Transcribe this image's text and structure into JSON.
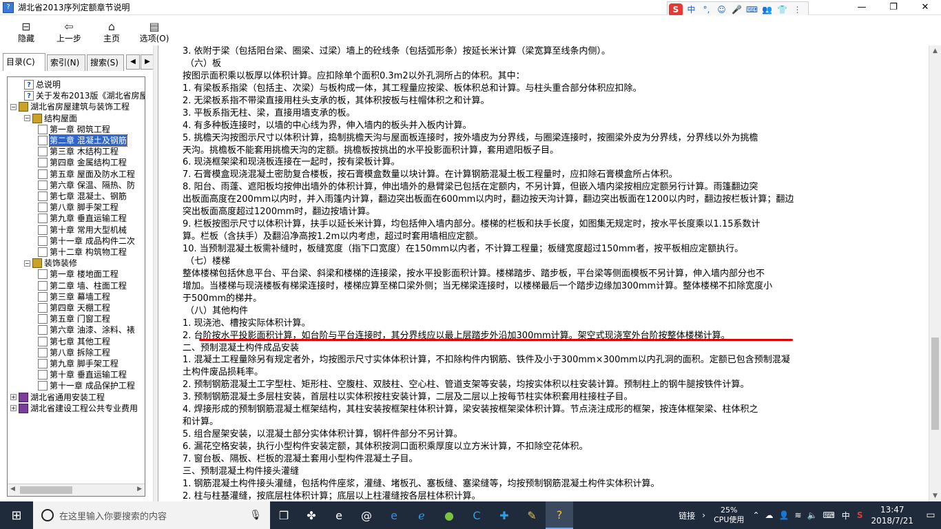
{
  "window": {
    "title": "湖北省2013序列定额章节说明",
    "app_icon": "help-file-icon",
    "minimize": "—",
    "maximize": "❐",
    "close": "✕"
  },
  "ime": {
    "logo": "S",
    "mode": "中",
    "items": [
      "°,",
      "☺",
      "🎤",
      "⌨",
      "👥",
      "👕",
      "⋮"
    ]
  },
  "toolbar": [
    {
      "label": "隐藏",
      "icon": "hide-icon",
      "glyph": "⊟"
    },
    {
      "label": "上一步",
      "icon": "back-icon",
      "glyph": "⇦"
    },
    {
      "label": "主页",
      "icon": "home-icon",
      "glyph": "⌂"
    },
    {
      "label": "选项(O)",
      "icon": "options-icon",
      "glyph": "▤"
    }
  ],
  "tabs": [
    "目录(C)",
    "索引(N)",
    "搜索(S)"
  ],
  "tree": [
    {
      "level": 1,
      "expander": "",
      "icon": "help-page-icon",
      "label": "总说明"
    },
    {
      "level": 1,
      "expander": "",
      "icon": "help-page-icon",
      "label": "关于发布2013版《湖北省房屋"
    },
    {
      "level": 0,
      "expander": "−",
      "icon": "open-book-icon",
      "label": "湖北省房屋建筑与装饰工程"
    },
    {
      "level": 1,
      "expander": "−",
      "icon": "open-book-icon",
      "label": "结构屋面"
    },
    {
      "level": 2,
      "expander": "",
      "icon": "page-icon",
      "label": "第一章 砌筑工程"
    },
    {
      "level": 2,
      "expander": "",
      "icon": "page-icon",
      "label": "第二章 混凝土及钢筋",
      "selected": true
    },
    {
      "level": 2,
      "expander": "",
      "icon": "page-icon",
      "label": "第三章 木结构工程"
    },
    {
      "level": 2,
      "expander": "",
      "icon": "page-icon",
      "label": "第四章 金属结构工程"
    },
    {
      "level": 2,
      "expander": "",
      "icon": "page-icon",
      "label": "第五章 屋面及防水工程"
    },
    {
      "level": 2,
      "expander": "",
      "icon": "page-icon",
      "label": "第六章 保温、隔热、防"
    },
    {
      "level": 2,
      "expander": "",
      "icon": "page-icon",
      "label": "第七章 混凝土、钢筋"
    },
    {
      "level": 2,
      "expander": "",
      "icon": "page-icon",
      "label": "第八章 脚手架工程"
    },
    {
      "level": 2,
      "expander": "",
      "icon": "page-icon",
      "label": "第九章 垂直运输工程"
    },
    {
      "level": 2,
      "expander": "",
      "icon": "page-icon",
      "label": "第十章 常用大型机械"
    },
    {
      "level": 2,
      "expander": "",
      "icon": "page-icon",
      "label": "第十一章 成品构件二次"
    },
    {
      "level": 2,
      "expander": "",
      "icon": "page-icon",
      "label": "第十二章 构筑物工程"
    },
    {
      "level": 1,
      "expander": "−",
      "icon": "open-book-icon",
      "label": "装饰装修"
    },
    {
      "level": 2,
      "expander": "",
      "icon": "page-icon",
      "label": "第一章 楼地面工程"
    },
    {
      "level": 2,
      "expander": "",
      "icon": "page-icon",
      "label": "第二章 墙、柱面工程"
    },
    {
      "level": 2,
      "expander": "",
      "icon": "page-icon",
      "label": "第三章 幕墙工程"
    },
    {
      "level": 2,
      "expander": "",
      "icon": "page-icon",
      "label": "第四章 天棚工程"
    },
    {
      "level": 2,
      "expander": "",
      "icon": "page-icon",
      "label": "第五章 门窗工程"
    },
    {
      "level": 2,
      "expander": "",
      "icon": "page-icon",
      "label": "第六章 油漆、涂料、裱"
    },
    {
      "level": 2,
      "expander": "",
      "icon": "page-icon",
      "label": "第七章 其他工程"
    },
    {
      "level": 2,
      "expander": "",
      "icon": "page-icon",
      "label": "第八章 拆除工程"
    },
    {
      "level": 2,
      "expander": "",
      "icon": "page-icon",
      "label": "第九章 脚手架工程"
    },
    {
      "level": 2,
      "expander": "",
      "icon": "page-icon",
      "label": "第十章 垂直运输工程"
    },
    {
      "level": 2,
      "expander": "",
      "icon": "page-icon",
      "label": "第十一章 成品保护工程"
    },
    {
      "level": 0,
      "expander": "+",
      "icon": "closed-book-icon",
      "label": "湖北省通用安装工程"
    },
    {
      "level": 0,
      "expander": "+",
      "icon": "closed-book-icon",
      "label": "湖北省建设工程公共专业费用"
    }
  ],
  "content": [
    {
      "text": "3. 依附于梁（包括阳台梁、圈梁、过梁）墙上的砼线条（包括弧形条）按延长米计算（梁宽算至线条内侧）。"
    },
    {
      "text": "（六）板",
      "sub": true
    },
    {
      "text": "按图示面积乘以板厚以体积计算。应扣除单个面积0.3m2以外孔洞所占的体积。其中："
    },
    {
      "text": "1. 有梁板系指梁（包括主、次梁）与板构成一体，其工程量应按梁、板体积总和计算。与柱头重合部分体积应扣除。"
    },
    {
      "text": "2. 无梁板系指不带梁直接用柱头支承的板，其体积按板与柱帽体积之和计算。"
    },
    {
      "text": "3. 平板系指无柱、梁，直接用墙支承的板。"
    },
    {
      "text": "4. 有多种板连接时，以墙的中心线为界，伸入墙内的板头并入板内计算。"
    },
    {
      "text": "5. 挑檐天沟按图示尺寸以体积计算，捣制挑檐天沟与屋面板连接时，按外墙皮为分界线，与圈梁连接时，按圈梁外皮为分界线，分界线以外为挑檐"
    },
    {
      "text": "天沟。挑檐板不能套用挑檐天沟的定额。挑檐板按挑出的水平投影面积计算，套用遮阳板子目。"
    },
    {
      "text": "6. 现浇框架梁和现浇板连接在一起时，按有梁板计算。"
    },
    {
      "text": "7. 石膏模盒现浇混凝土密肋复合楼板，按石膏模盒数量以块计算。在计算钢筋混凝土板工程量时，应扣除石膏模盒所占体积。"
    },
    {
      "text": "8. 阳台、雨蓬、遮阳板均按伸出墙外的体积计算，伸出墙外的悬臂梁已包括在定额内，不另计算，但嵌入墙内梁按相应定额另行计算。雨篷翻边突"
    },
    {
      "text": "出板面高度在200mm以内时，并入雨篷内计算，翻边突出板面在600mm以内时，翻边按天沟计算，翻边突出板面在1200以内时，翻边按栏板计算；翻边"
    },
    {
      "text": "突出板面高度超过1200mm时，翻边按墙计算。"
    },
    {
      "text": "9. 栏板按图示尺寸以体积计算，扶手以延长米计算，均包括伸入墙内部分。楼梯的栏板和扶手长度，如图集无规定时，按水平长度乘以1.15系数计"
    },
    {
      "text": "算。栏板（含扶手）及翻沿净高按1.2m以内考虑，超过时套用墙相应定额。"
    },
    {
      "text": "10. 当预制混凝土板需补缝时，板缝宽度（指下口宽度）在150mm以内者，不计算工程量；板缝宽度超过150mm者，按平板相应定额执行。"
    },
    {
      "text": "（七）楼梯",
      "sub": true
    },
    {
      "text": "整体楼梯包括休息平台、平台梁、斜梁和楼梯的连接梁，按水平投影面积计算。楼梯踏步、踏步板，平台梁等侧面模板不另计算，伸入墙内部分也不"
    },
    {
      "text": "增加。当楼梯与现浇楼板有梯梁连接时，楼梯应算至梯口梁外侧；当无梯梁连接时，以楼梯最后一个踏步边缘加300mm计算。整体楼梯不扣除宽度小"
    },
    {
      "text": "于500mm的梯井。"
    },
    {
      "text": "（八）其他构件",
      "sub": true
    },
    {
      "text": "1. 现浇池、槽按实际体积计算。"
    },
    {
      "text": "2. 台阶按水平投影面积计算，如台阶与平台连接时，其分界线应以最上层踏步外沿加300mm计算。架空式现浇室外台阶按整体楼梯计算。"
    },
    {
      "text": "二、预制混凝土构件成品安装"
    },
    {
      "text": "1. 混凝土工程量除另有规定者外，均按图示尺寸实体体积计算，不扣除构件内钢筋、铁件及小于300mm×300mm以内孔洞的面积。定额已包含预制混凝"
    },
    {
      "text": "土构件废品损耗率。"
    },
    {
      "text": "2. 预制钢筋混凝土工字型柱、矩形柱、空腹柱、双肢柱、空心柱、管道支架等安装，均按实体积以柱安装计算。预制柱上的钢牛腿按铁件计算。"
    },
    {
      "text": "3. 预制钢筋混凝土多层柱安装，首层柱以实体积按柱安装计算，二层及二层以上按每节柱实体积套用柱接柱子目。"
    },
    {
      "text": "4. 焊接形成的预制钢筋混凝土框架结构，其柱安装按框架柱体积计算，梁安装按框架梁体积计算。节点浇注成形的框架，按连体框架梁、柱体积之"
    },
    {
      "text": "和计算。"
    },
    {
      "text": "5. 组合屋架安装，以混凝土部分实体体积计算，钢杆件部分不另计算。"
    },
    {
      "text": "6. 漏花空格安装，执行小型构件安装定额，其体积按洞口面积乘厚度以立方米计算，不扣除空花体积。"
    },
    {
      "text": "7. 窗台板、隔板、栏板的混凝土套用小型构件混凝土子目。"
    },
    {
      "text": "三、预制混凝土构件接头灌缝"
    },
    {
      "text": "1. 钢筋混凝土构件接头灌缝，包括构件座浆，灌缝、堵板孔、塞板缝、塞梁缝等，均按预制钢筋混凝土构件实体积计算。"
    },
    {
      "text": "2. 柱与柱基灌缝，按底层柱体积计算；底层以上柱灌缝按各层柱体积计算。"
    }
  ],
  "annotation_color": "#e00000",
  "taskbar": {
    "search_placeholder": "在这里输入你要搜索的内容",
    "apps": [
      "task-view-icon",
      "fan-icon",
      "ie-icon",
      "spiral-icon",
      "edge-icon",
      "ie-blue-icon",
      "green-app-icon",
      "c-browser-icon",
      "plus-app-icon",
      "notes-icon",
      "help-app-icon"
    ],
    "tray_link": "链接",
    "cpu_percent": "25%",
    "cpu_label": "CPU使用",
    "lang": "中",
    "time": "13:47",
    "date": "2018/7/21"
  }
}
